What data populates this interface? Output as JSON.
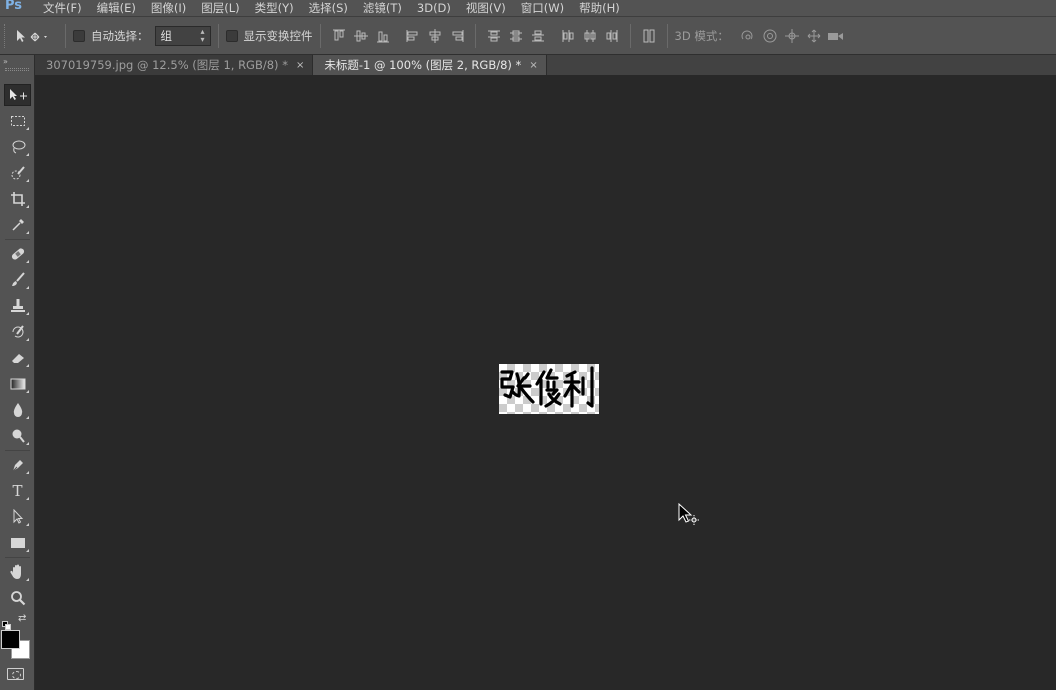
{
  "app": {
    "logo": "Ps"
  },
  "menu": [
    "文件(F)",
    "编辑(E)",
    "图像(I)",
    "图层(L)",
    "类型(Y)",
    "选择(S)",
    "滤镜(T)",
    "3D(D)",
    "视图(V)",
    "窗口(W)",
    "帮助(H)"
  ],
  "options": {
    "auto_select_label": "自动选择：",
    "auto_select_checked": false,
    "auto_select_value": "组",
    "show_transform_label": "显示变换控件",
    "show_transform_checked": false,
    "mode_3d_label": "3D 模式："
  },
  "tabs": [
    {
      "label": "307019759.jpg @ 12.5% (图层 1, RGB/8) *",
      "active": false,
      "close": "×"
    },
    {
      "label": "未标题-1 @ 100% (图层 2, RGB/8) *",
      "active": true,
      "close": "×"
    }
  ],
  "tools": [
    "move",
    "rectangular-marquee",
    "lasso",
    "quick-selection",
    "crop",
    "eyedropper",
    "spot-healing-brush",
    "brush",
    "clone-stamp",
    "history-brush",
    "eraser",
    "gradient",
    "blur",
    "dodge",
    "pen",
    "type",
    "path-selection",
    "rectangle",
    "hand",
    "zoom"
  ],
  "type_tool_glyph": "T",
  "colors": {
    "foreground": "#000000",
    "background": "#ffffff",
    "canvas_bg": "#282828",
    "panel_bg": "#535353"
  },
  "document": {
    "content": "张俊利",
    "content_style": "handwritten signature on transparent layer"
  }
}
